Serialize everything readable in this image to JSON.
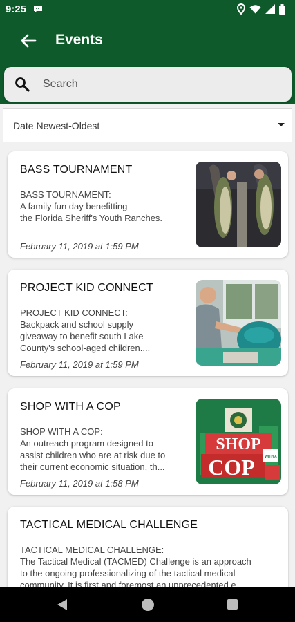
{
  "status_bar": {
    "time": "9:25"
  },
  "app_bar": {
    "title": "Events"
  },
  "search": {
    "placeholder": "Search"
  },
  "sort": {
    "selected": "Date Newest-Oldest"
  },
  "events": [
    {
      "title": "BASS TOURNAMENT",
      "description_lines": [
        "BASS TOURNAMENT:",
        "A family fun day benefitting",
        "the Florida Sheriff's Youth Ranches."
      ],
      "date": "February 11, 2019 at 1:59 PM"
    },
    {
      "title": "PROJECT KID CONNECT",
      "description_lines": [
        "PROJECT KID CONNECT:",
        "Backpack and school supply",
        "giveaway to benefit south Lake",
        "County's school-aged children...."
      ],
      "date": "February 11, 2019 at 1:59 PM"
    },
    {
      "title": "SHOP WITH A COP",
      "description_lines": [
        "SHOP WITH A COP:",
        "An outreach program designed to",
        "assist children who are at risk due to",
        "their current economic situation, th..."
      ],
      "date": "February 11, 2019 at 1:58 PM",
      "thumb_text": {
        "shop": "SHOP",
        "with_a": "WITH A",
        "cop": "COP"
      }
    },
    {
      "title": "TACTICAL MEDICAL CHALLENGE",
      "description_lines": [
        "TACTICAL MEDICAL CHALLENGE:",
        "The Tactical Medical (TACMED) Challenge is an approach",
        "to the ongoing professionalizing of the tactical medical",
        "community. It is first and foremost an unprecedented e..."
      ]
    }
  ],
  "colors": {
    "header": "#0e5a2a",
    "background": "#f1f1f1",
    "card": "#ffffff"
  }
}
